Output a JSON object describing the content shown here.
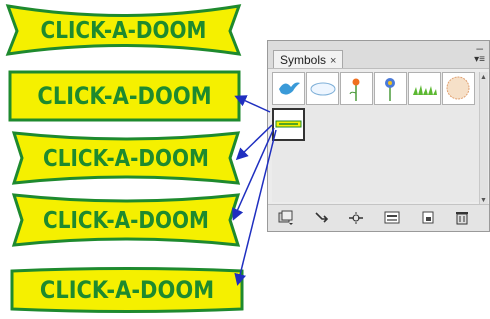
{
  "banners": [
    {
      "text": "CLICK-A-DOOM"
    },
    {
      "text": "CLICK-A-DOOM"
    },
    {
      "text": "CLICK-A-DOOM"
    },
    {
      "text": "CLICK-A-DOOM"
    },
    {
      "text": "CLICK-A-DOOM"
    }
  ],
  "colors": {
    "banner_fill": "#f5f000",
    "banner_stroke": "#1e8a2e",
    "arrow": "#1f2fc0"
  },
  "panel": {
    "tab_label": "Symbols",
    "tab_close": "×",
    "minimize": "–",
    "menu": "▾≡",
    "symbols": [
      {
        "name": "bird-symbol"
      },
      {
        "name": "cloud-symbol"
      },
      {
        "name": "flower-orange-symbol"
      },
      {
        "name": "flower-blue-symbol"
      },
      {
        "name": "grass-symbol"
      },
      {
        "name": "dandelion-symbol"
      },
      {
        "name": "click-a-doom-symbol",
        "selected": true
      }
    ],
    "toolbar_icons": [
      "symbol-libraries-menu-icon",
      "place-symbol-instance-icon",
      "break-link-icon",
      "symbol-options-icon",
      "new-symbol-icon",
      "delete-symbol-icon"
    ]
  }
}
